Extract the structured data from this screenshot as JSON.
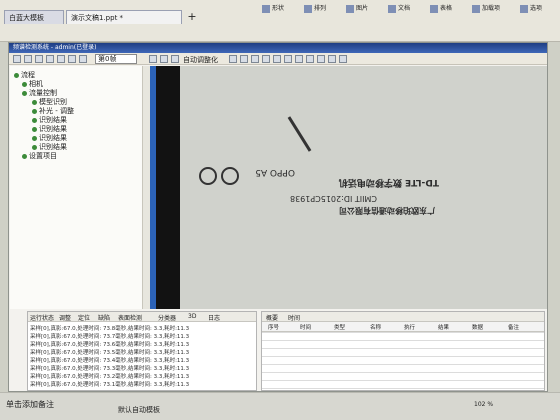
{
  "app": {
    "tabs": [
      {
        "label": "白蓝大模板"
      },
      {
        "label": "演示文稿1.ppt *",
        "active": true
      }
    ],
    "tab_plus": "+",
    "ribbon_items": [
      {
        "label": "形状",
        "icon": "shape-icon"
      },
      {
        "label": "排列",
        "icon": "arrange-icon"
      },
      {
        "label": "图片",
        "icon": "picture-icon"
      },
      {
        "label": "文档",
        "icon": "document-icon"
      },
      {
        "label": "表格",
        "icon": "table-icon"
      },
      {
        "label": "加载项",
        "icon": "addin-icon"
      },
      {
        "label": "选项",
        "icon": "option-icon"
      }
    ]
  },
  "window": {
    "title": "频谱检测系统 - admin(已登录)",
    "frame_select": "第0帧",
    "zoom_label": "自动调整化"
  },
  "tree": {
    "items": [
      {
        "label": "流程",
        "level": 0
      },
      {
        "label": "相机",
        "level": 1
      },
      {
        "label": "流量控制",
        "level": 1
      },
      {
        "label": "模型识别",
        "level": 2
      },
      {
        "label": "补光 - 调整",
        "level": 2
      },
      {
        "label": "识别结果",
        "level": 2
      },
      {
        "label": "识别结果",
        "level": 2
      },
      {
        "label": "识别结果",
        "level": 2
      },
      {
        "label": "识别结果",
        "level": 2
      },
      {
        "label": "设置项目",
        "level": 1
      }
    ]
  },
  "image": {
    "line1": "OPPO A5",
    "line2": "TD-LTE 数字移动电话机",
    "line3": "CMIIT ID:2015CP1938",
    "line4": "广东欧珀移动通信有限公司"
  },
  "log": {
    "tabs": [
      "运行状态",
      "调整",
      "定位",
      "缺陷",
      "表面检测",
      "分类器",
      "3D",
      "日志"
    ],
    "lines": [
      "采样[0],真影:67.0,处理时间: 73.8毫秒,结果时间: 3.3,耗时:11.3",
      "采样[0],真影:67.0,处理时间: 73.7毫秒,结果时间: 3.3,耗时:11.3",
      "采样[0],真影:67.0,处理时间: 73.6毫秒,结果时间: 3.3,耗时:11.3",
      "采样[0],真影:67.0,处理时间: 73.5毫秒,结果时间: 3.3,耗时:11.3",
      "采样[0],真影:67.0,处理时间: 73.4毫秒,结果时间: 3.3,耗时:11.3",
      "采样[0],真影:67.0,处理时间: 73.3毫秒,结果时间: 3.3,耗时:11.3",
      "采样[0],真影:67.0,处理时间: 73.2毫秒,结果时间: 3.3,耗时:11.3",
      "采样[0],真影:67.0,处理时间: 73.1毫秒,结果时间: 3.3,耗时:11.3"
    ]
  },
  "table": {
    "tabs": [
      "概要",
      "时间"
    ],
    "headers": [
      "序号",
      "时间",
      "类型",
      "名称",
      "执行",
      "结果",
      "数据",
      "备注"
    ]
  },
  "status": {
    "note": "单击添加备注",
    "bottom": "默认自动模板",
    "zoom": "102 %"
  }
}
